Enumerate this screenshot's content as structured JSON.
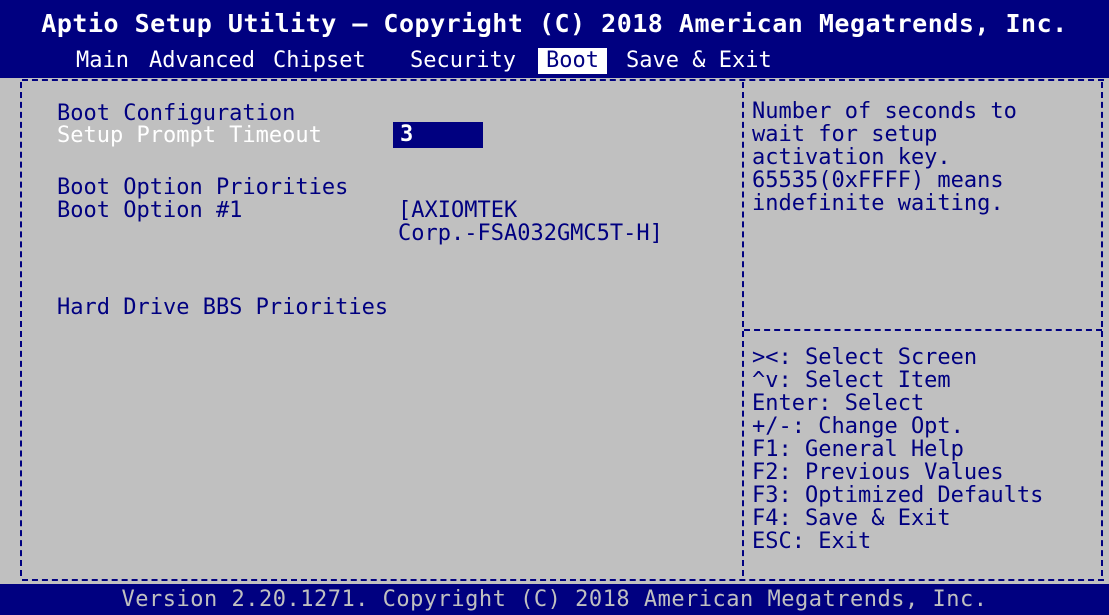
{
  "header": {
    "title": "Aptio Setup Utility – Copyright (C) 2018 American Megatrends, Inc.",
    "menu": [
      {
        "label": "Main"
      },
      {
        "label": "Advanced"
      },
      {
        "label": "Chipset"
      },
      {
        "label": "Security"
      },
      {
        "label": "Boot",
        "selected": true
      },
      {
        "label": "Save & Exit"
      }
    ]
  },
  "main": {
    "boot_configuration": "Boot Configuration",
    "setup_prompt_timeout": {
      "label": "Setup Prompt Timeout",
      "value": "3"
    },
    "boot_option_priorities": "Boot Option Priorities",
    "boot_option_1": {
      "label": "Boot Option #1",
      "value_line1": "[AXIOMTEK",
      "value_line2": "Corp.-FSA032GMC5T-H]"
    },
    "hard_drive_bbs": "Hard Drive BBS Priorities"
  },
  "help": {
    "description": [
      "Number of seconds to",
      "wait for setup",
      "activation key.",
      "65535(0xFFFF) means",
      "indefinite waiting."
    ],
    "keys": [
      "><: Select Screen",
      "^v: Select Item",
      "Enter: Select",
      "+/-: Change Opt.",
      "F1: General Help",
      "F2: Previous Values",
      "F3: Optimized Defaults",
      "F4: Save & Exit",
      "ESC: Exit"
    ]
  },
  "footer": {
    "version": "Version 2.20.1271. Copyright (C) 2018 American Megatrends, Inc."
  },
  "colors": {
    "bios_blue": "#000080",
    "panel_gray": "#c0c0c0",
    "highlight_white": "#ffffff"
  }
}
